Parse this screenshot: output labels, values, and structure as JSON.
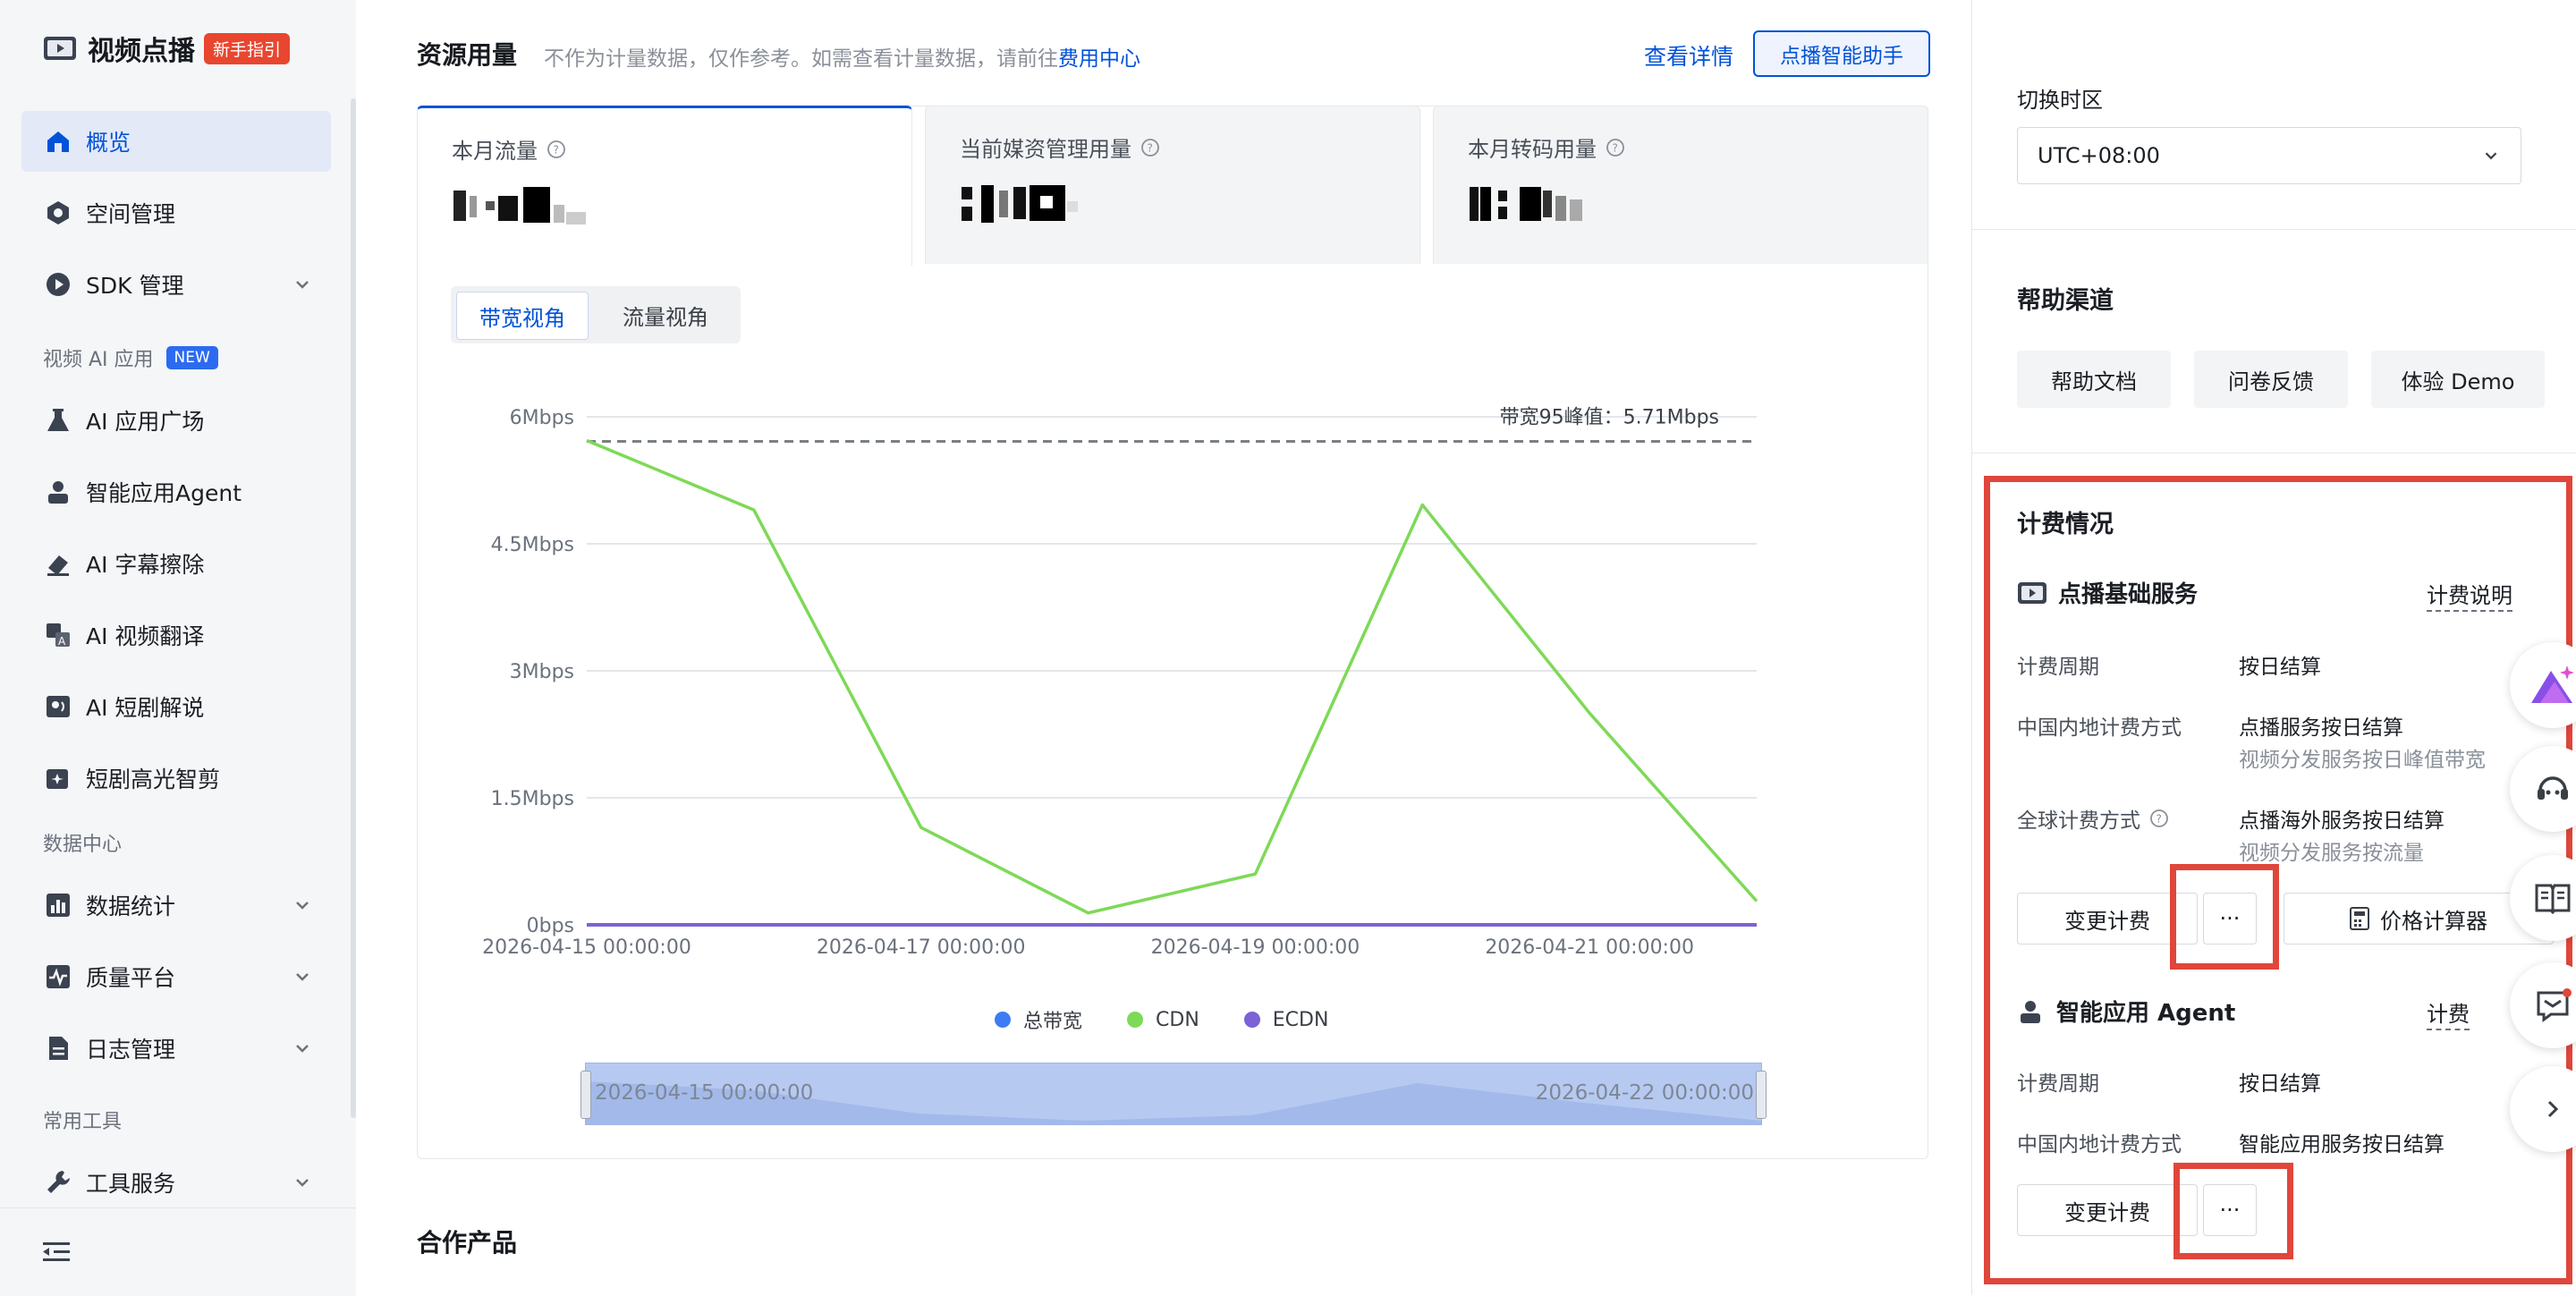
{
  "brand": {
    "title": "视频点播",
    "badge": "新手指引"
  },
  "sidebar": {
    "items": [
      {
        "label": "概览",
        "active": true
      },
      {
        "label": "空间管理"
      },
      {
        "label": "SDK 管理",
        "expandable": true
      },
      {
        "label": "AI 应用广场"
      },
      {
        "label": "智能应用Agent"
      },
      {
        "label": "AI 字幕擦除"
      },
      {
        "label": "AI 视频翻译"
      },
      {
        "label": "AI 短剧解说"
      },
      {
        "label": "短剧高光智剪"
      },
      {
        "label": "数据统计",
        "expandable": true
      },
      {
        "label": "质量平台",
        "expandable": true
      },
      {
        "label": "日志管理",
        "expandable": true
      },
      {
        "label": "工具服务",
        "expandable": true
      }
    ],
    "sections": {
      "ai": "视频 AI 应用",
      "ai_tag": "NEW",
      "data": "数据中心",
      "tools": "常用工具"
    }
  },
  "resource": {
    "title": "资源用量",
    "note": "不作为计量数据，仅作参考。如需查看计量数据，请前往",
    "note_link": "费用中心",
    "detail_link": "查看详情",
    "assistant_button": "点播智能助手",
    "tabs": [
      {
        "label": "本月流量",
        "active": true
      },
      {
        "label": "当前媒资管理用量"
      },
      {
        "label": "本月转码用量"
      }
    ],
    "view_toggle": {
      "bandwidth": "带宽视角",
      "traffic": "流量视角",
      "selected": "bandwidth"
    },
    "peak_label": "带宽95峰值：5.71Mbps",
    "legend": [
      {
        "name": "总带宽",
        "color": "#3d7cf3"
      },
      {
        "name": "CDN",
        "color": "#7ed957"
      },
      {
        "name": "ECDN",
        "color": "#7b62d6"
      }
    ],
    "zoom": {
      "start": "2026-04-15 00:00:00",
      "end": "2026-04-22 00:00:00"
    }
  },
  "chart_data": {
    "type": "line",
    "y_ticks": [
      "0bps",
      "1.5Mbps",
      "3Mbps",
      "4.5Mbps",
      "6Mbps"
    ],
    "ylim": [
      0,
      6
    ],
    "x_ticks": [
      "2026-04-15 00:00:00",
      "2026-04-17 00:00:00",
      "2026-04-19 00:00:00",
      "2026-04-21 00:00:00"
    ],
    "x_days": [
      0,
      1,
      2,
      3,
      4,
      5,
      6,
      7
    ],
    "series": [
      {
        "name": "CDN",
        "color": "#7ed957",
        "values": [
          5.72,
          4.9,
          1.15,
          0.14,
          0.6,
          4.96,
          2.5,
          0.28
        ]
      },
      {
        "name": "ECDN",
        "color": "#7b62d6",
        "values": [
          0,
          0,
          0,
          0,
          0,
          0,
          0,
          0
        ]
      }
    ],
    "peak_line": 5.71,
    "grid": true,
    "legend_position": "bottom"
  },
  "partner": {
    "title": "合作产品"
  },
  "right": {
    "timezone_label": "切换时区",
    "timezone_value": "UTC+08:00",
    "help_title": "帮助渠道",
    "help_buttons": [
      "帮助文档",
      "问卷反馈",
      "体验 Demo"
    ],
    "billing": {
      "title": "计费情况",
      "services": [
        {
          "name": "点播基础服务",
          "doc_link": "计费说明",
          "cycle_key": "计费周期",
          "cycle_val": "按日结算",
          "mainland_key": "中国内地计费方式",
          "mainland_val": "点播服务按日结算",
          "mainland_sub": "视频分发服务按日峰值带宽",
          "global_key": "全球计费方式",
          "global_val": "点播海外服务按日结算",
          "global_sub": "视频分发服务按流量",
          "change_button": "变更计费",
          "more_button": "···",
          "calc_button": "价格计算器"
        },
        {
          "name": "智能应用 Agent",
          "doc_link": "计费",
          "cycle_key": "计费周期",
          "cycle_val": "按日结算",
          "mainland_key": "中国内地计费方式",
          "mainland_val": "智能应用服务按日结算",
          "change_button": "变更计费",
          "more_button": "···"
        }
      ]
    }
  }
}
